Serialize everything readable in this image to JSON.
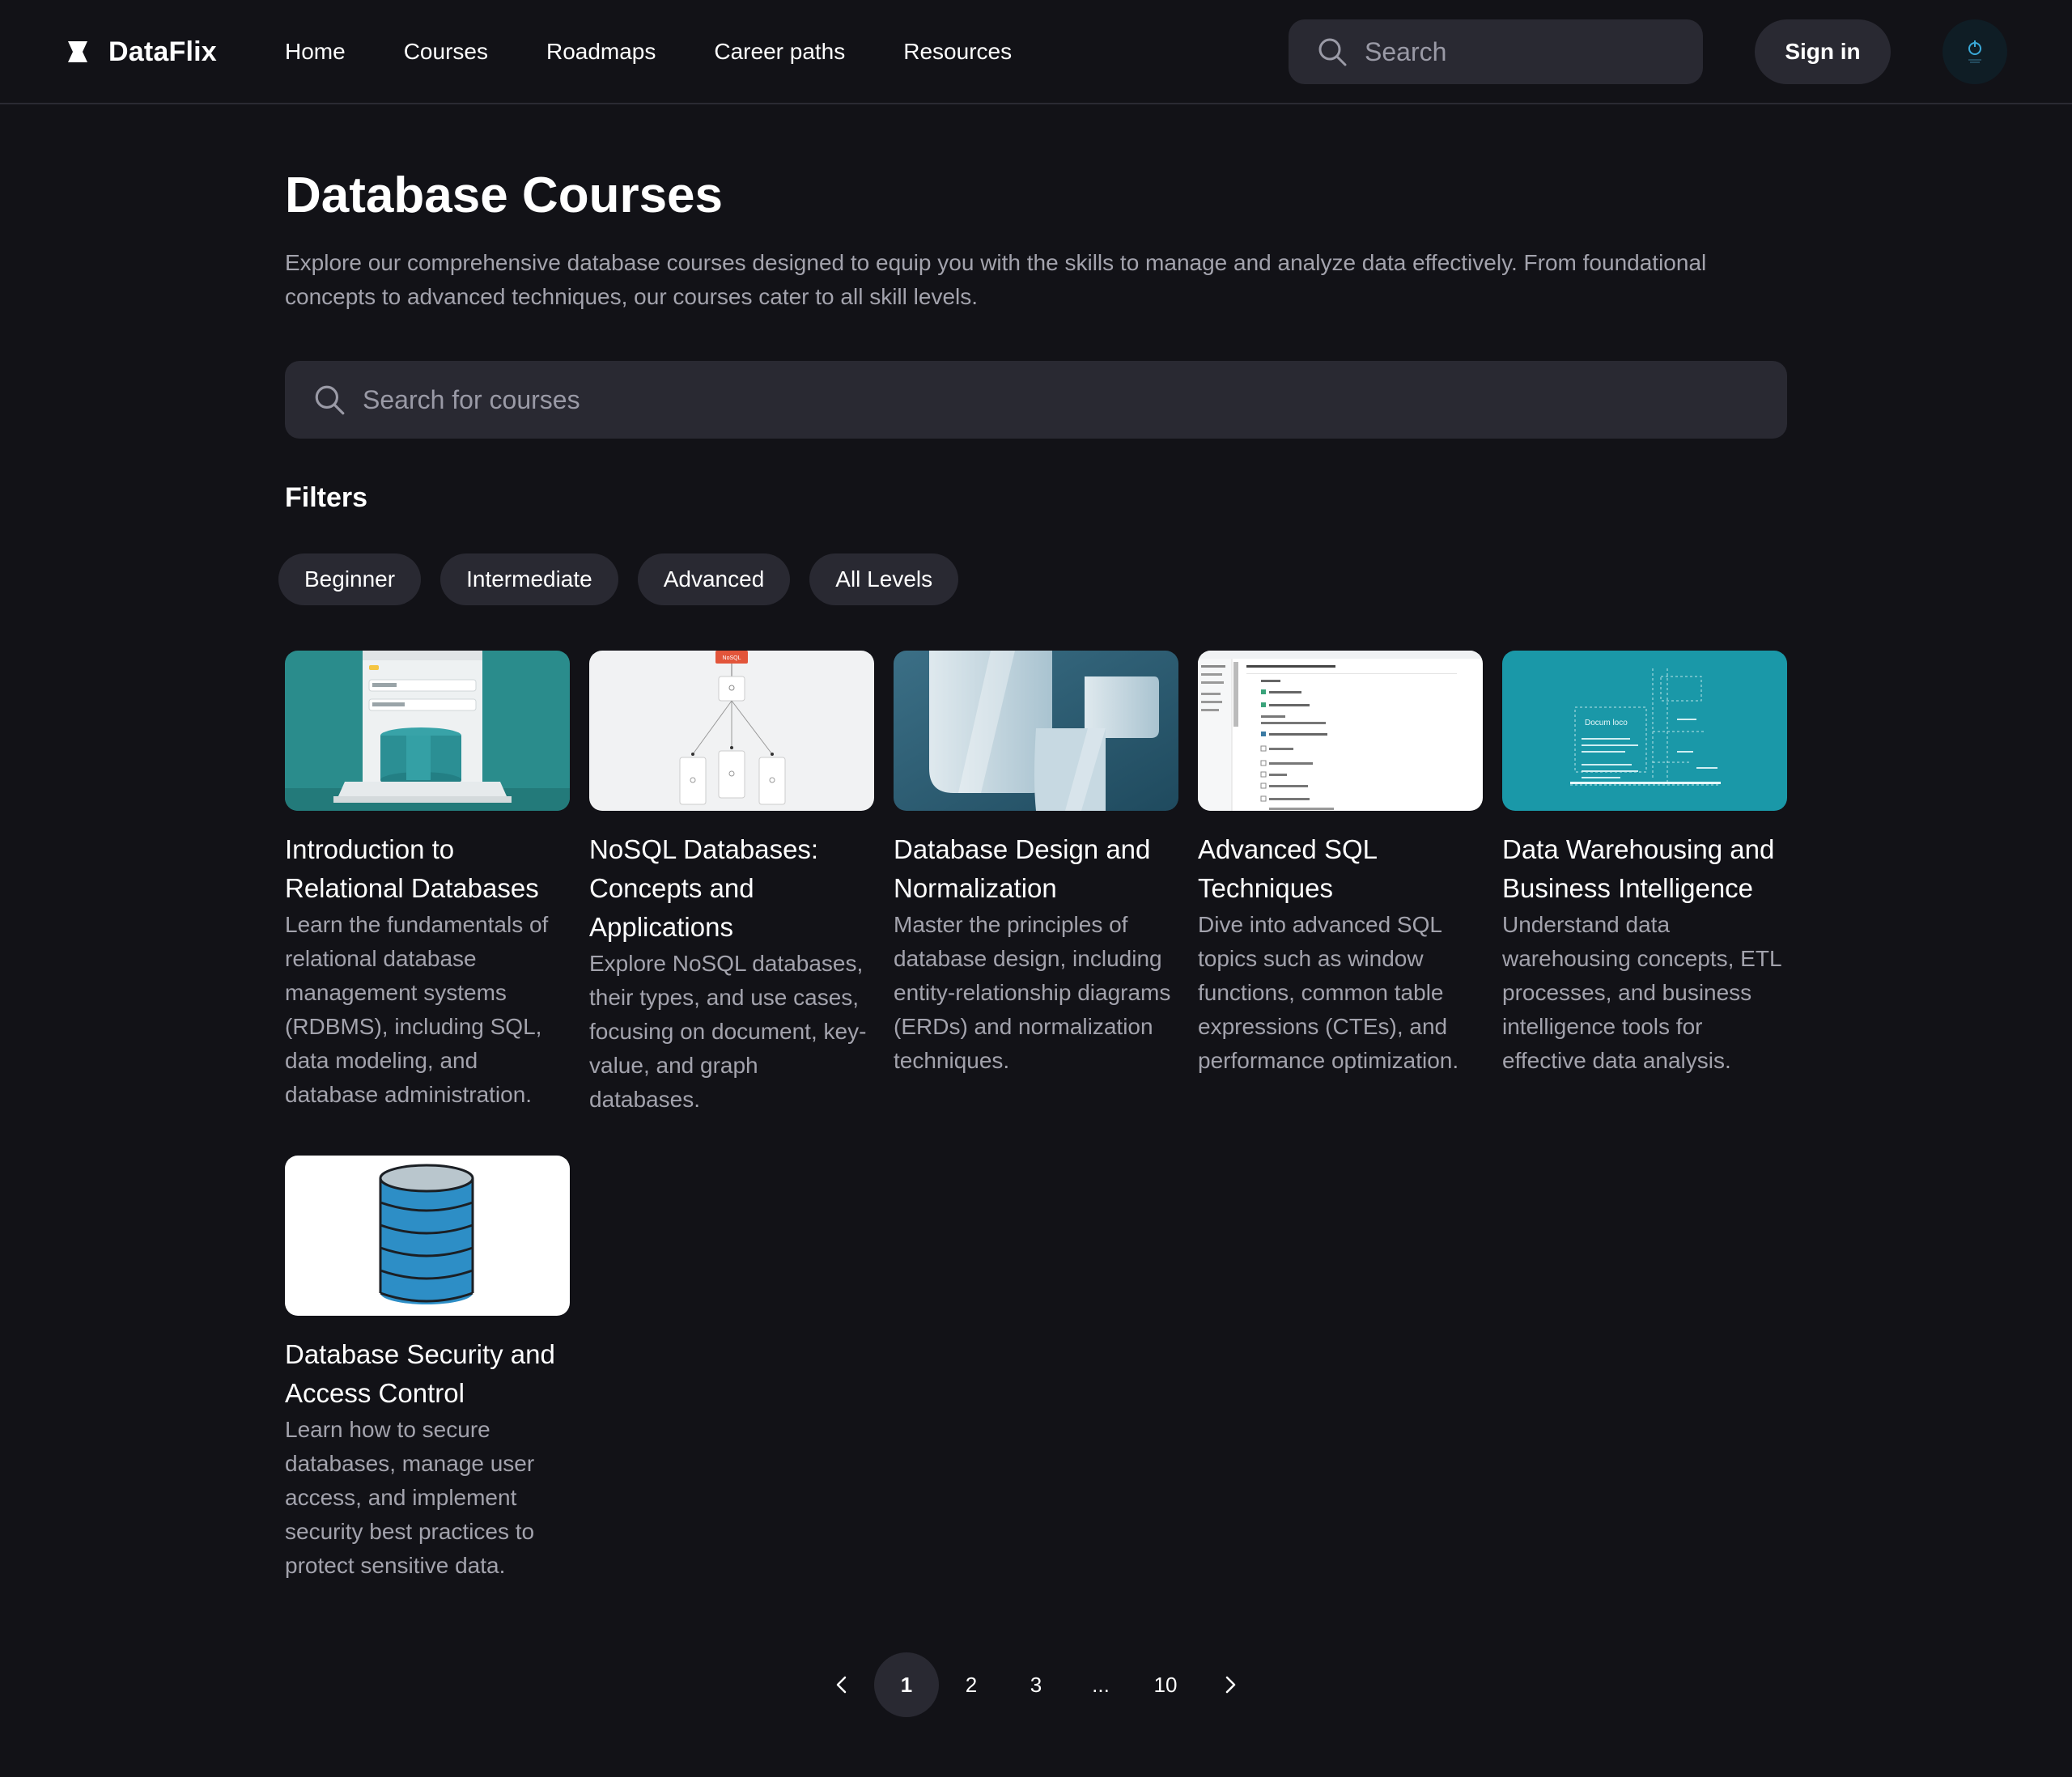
{
  "header": {
    "brand": "DataFlix",
    "nav": [
      "Home",
      "Courses",
      "Roadmaps",
      "Career paths",
      "Resources"
    ],
    "search_placeholder": "Search",
    "signin_label": "Sign in"
  },
  "main": {
    "title": "Database Courses",
    "description": "Explore our comprehensive database courses designed to equip you with the skills to manage and analyze data effectively. From foundational concepts to advanced techniques, our courses cater to all skill levels.",
    "search_placeholder": "Search for courses",
    "filters_title": "Filters",
    "filters": [
      "Beginner",
      "Intermediate",
      "Advanced",
      "All Levels"
    ]
  },
  "courses": [
    {
      "title": "Introduction to Relational Databases",
      "description": "Learn the fundamentals of relational database management systems (RDBMS), including SQL, data modeling, and database administration."
    },
    {
      "title": "NoSQL Databases: Concepts and Applications",
      "description": "Explore NoSQL databases, their types, and use cases, focusing on document, key-value, and graph databases."
    },
    {
      "title": "Database Design and Normalization",
      "description": "Master the principles of database design, including entity-relationship diagrams (ERDs) and normalization techniques."
    },
    {
      "title": "Advanced SQL Techniques",
      "description": "Dive into advanced SQL topics such as window functions, common table expressions (CTEs), and performance optimization."
    },
    {
      "title": "Data Warehousing and Business Intelligence",
      "description": "Understand data warehousing concepts, ETL processes, and business intelligence tools for effective data analysis."
    },
    {
      "title": "Database Security and Access Control",
      "description": "Learn how to secure databases, manage user access, and implement security best practices to protect sensitive data."
    }
  ],
  "thumbnails": {
    "nosql_tag": "NoSQL",
    "warehouse_label": "Docum loco"
  },
  "pagination": {
    "prev_icon": "chevron-left-icon",
    "pages": [
      "1",
      "2",
      "3",
      "...",
      "10"
    ],
    "current": "1",
    "next_icon": "chevron-right-icon"
  },
  "colors": {
    "background": "#121217",
    "surface": "#292932",
    "muted_text": "#a3a3ad",
    "teal": "#2a8c8c",
    "cyan": "#1a98a8",
    "db_blue": "#2d8ec6"
  }
}
